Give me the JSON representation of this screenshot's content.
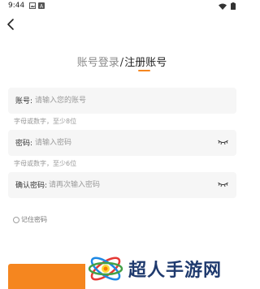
{
  "status_bar": {
    "time": "9:44"
  },
  "tabs": {
    "login_label": "账号登录",
    "separator": "/",
    "register_label": "注册账号",
    "active_color": "#f5861f"
  },
  "form": {
    "account": {
      "label": "账号:",
      "placeholder": "请输入您的账号",
      "hint": "字母或数字，至少8位"
    },
    "password": {
      "label": "密码:",
      "placeholder": "请输入密码",
      "hint": "字母或数字，至少6位"
    },
    "confirm": {
      "label": "确认密码:",
      "placeholder": "请再次输入密码"
    },
    "remember_label": "记住密码"
  },
  "watermark": {
    "text": "超人手游网"
  }
}
